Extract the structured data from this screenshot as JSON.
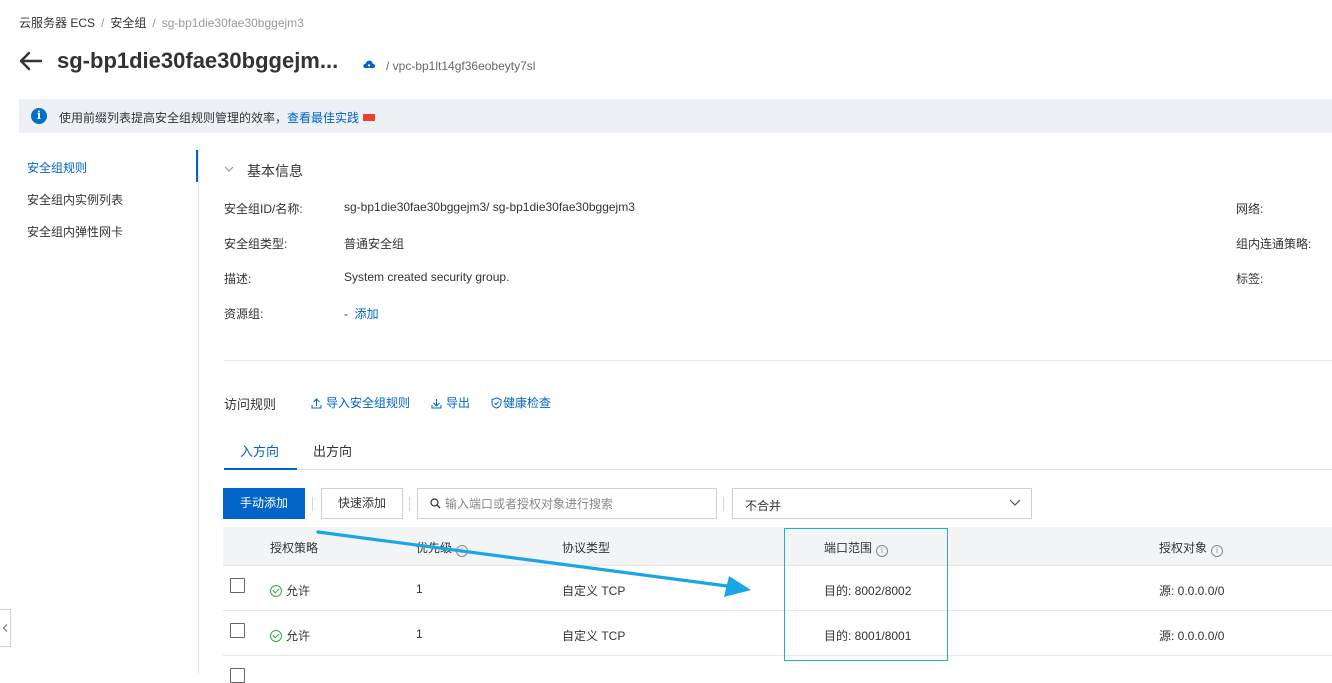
{
  "breadcrumb": {
    "items": [
      "云服务器 ECS",
      "安全组"
    ],
    "current": "sg-bp1die30fae30bggejm3",
    "separator": "/"
  },
  "header": {
    "title": "sg-bp1die30fae30bggejm...",
    "vpc": "/ vpc-bp1lt14gf36eobeyty7sl"
  },
  "notice": {
    "text": "使用前缀列表提高安全组规则管理的效率，",
    "link": "查看最佳实践"
  },
  "sidebar": {
    "items": [
      {
        "label": "安全组规则",
        "active": true
      },
      {
        "label": "安全组内实例列表",
        "active": false
      },
      {
        "label": "安全组内弹性网卡",
        "active": false
      }
    ]
  },
  "basic_info": {
    "title": "基本信息",
    "fields": [
      {
        "label": "安全组ID/名称:",
        "value": "sg-bp1die30fae30bggejm3/ sg-bp1die30fae30bggejm3"
      },
      {
        "label": "安全组类型:",
        "value": "普通安全组"
      },
      {
        "label": "描述:",
        "value": "System created security group."
      },
      {
        "label": "资源组:",
        "value": "-",
        "action": "添加"
      }
    ],
    "right_labels": [
      "网络:",
      "组内连通策略:",
      "标签:"
    ]
  },
  "rules": {
    "title": "访问规则",
    "actions": {
      "import": "导入安全组规则",
      "export": "导出",
      "health": "健康检查"
    },
    "tabs": [
      {
        "label": "入方向",
        "active": true
      },
      {
        "label": "出方向",
        "active": false
      }
    ],
    "toolbar": {
      "manual_add": "手动添加",
      "quick_add": "快速添加",
      "search_placeholder": "输入端口或者授权对象进行搜索",
      "merge_select": "不合并"
    },
    "columns": [
      "授权策略",
      "优先级",
      "协议类型",
      "端口范围",
      "授权对象"
    ],
    "rows": [
      {
        "policy": "允许",
        "priority": "1",
        "protocol": "自定义 TCP",
        "port": "目的: 8002/8002",
        "source": "源: 0.0.0.0/0"
      },
      {
        "policy": "允许",
        "priority": "1",
        "protocol": "自定义 TCP",
        "port": "目的: 8001/8001",
        "source": "源: 0.0.0.0/0"
      }
    ]
  },
  "icons": {
    "back": "arrow-left-icon",
    "cloud": "cloud-icon",
    "info": "info-icon",
    "chevron": "chevron-down-icon",
    "upload": "upload-icon",
    "download": "download-icon",
    "shield": "shield-check-icon",
    "search": "search-icon",
    "allow": "check-circle-icon"
  },
  "colors": {
    "primary": "#0064c8",
    "annotation": "#29a9e0",
    "success": "#2fa84f",
    "new_badge": "#e8432f",
    "notice_bg": "#edf1f6"
  }
}
